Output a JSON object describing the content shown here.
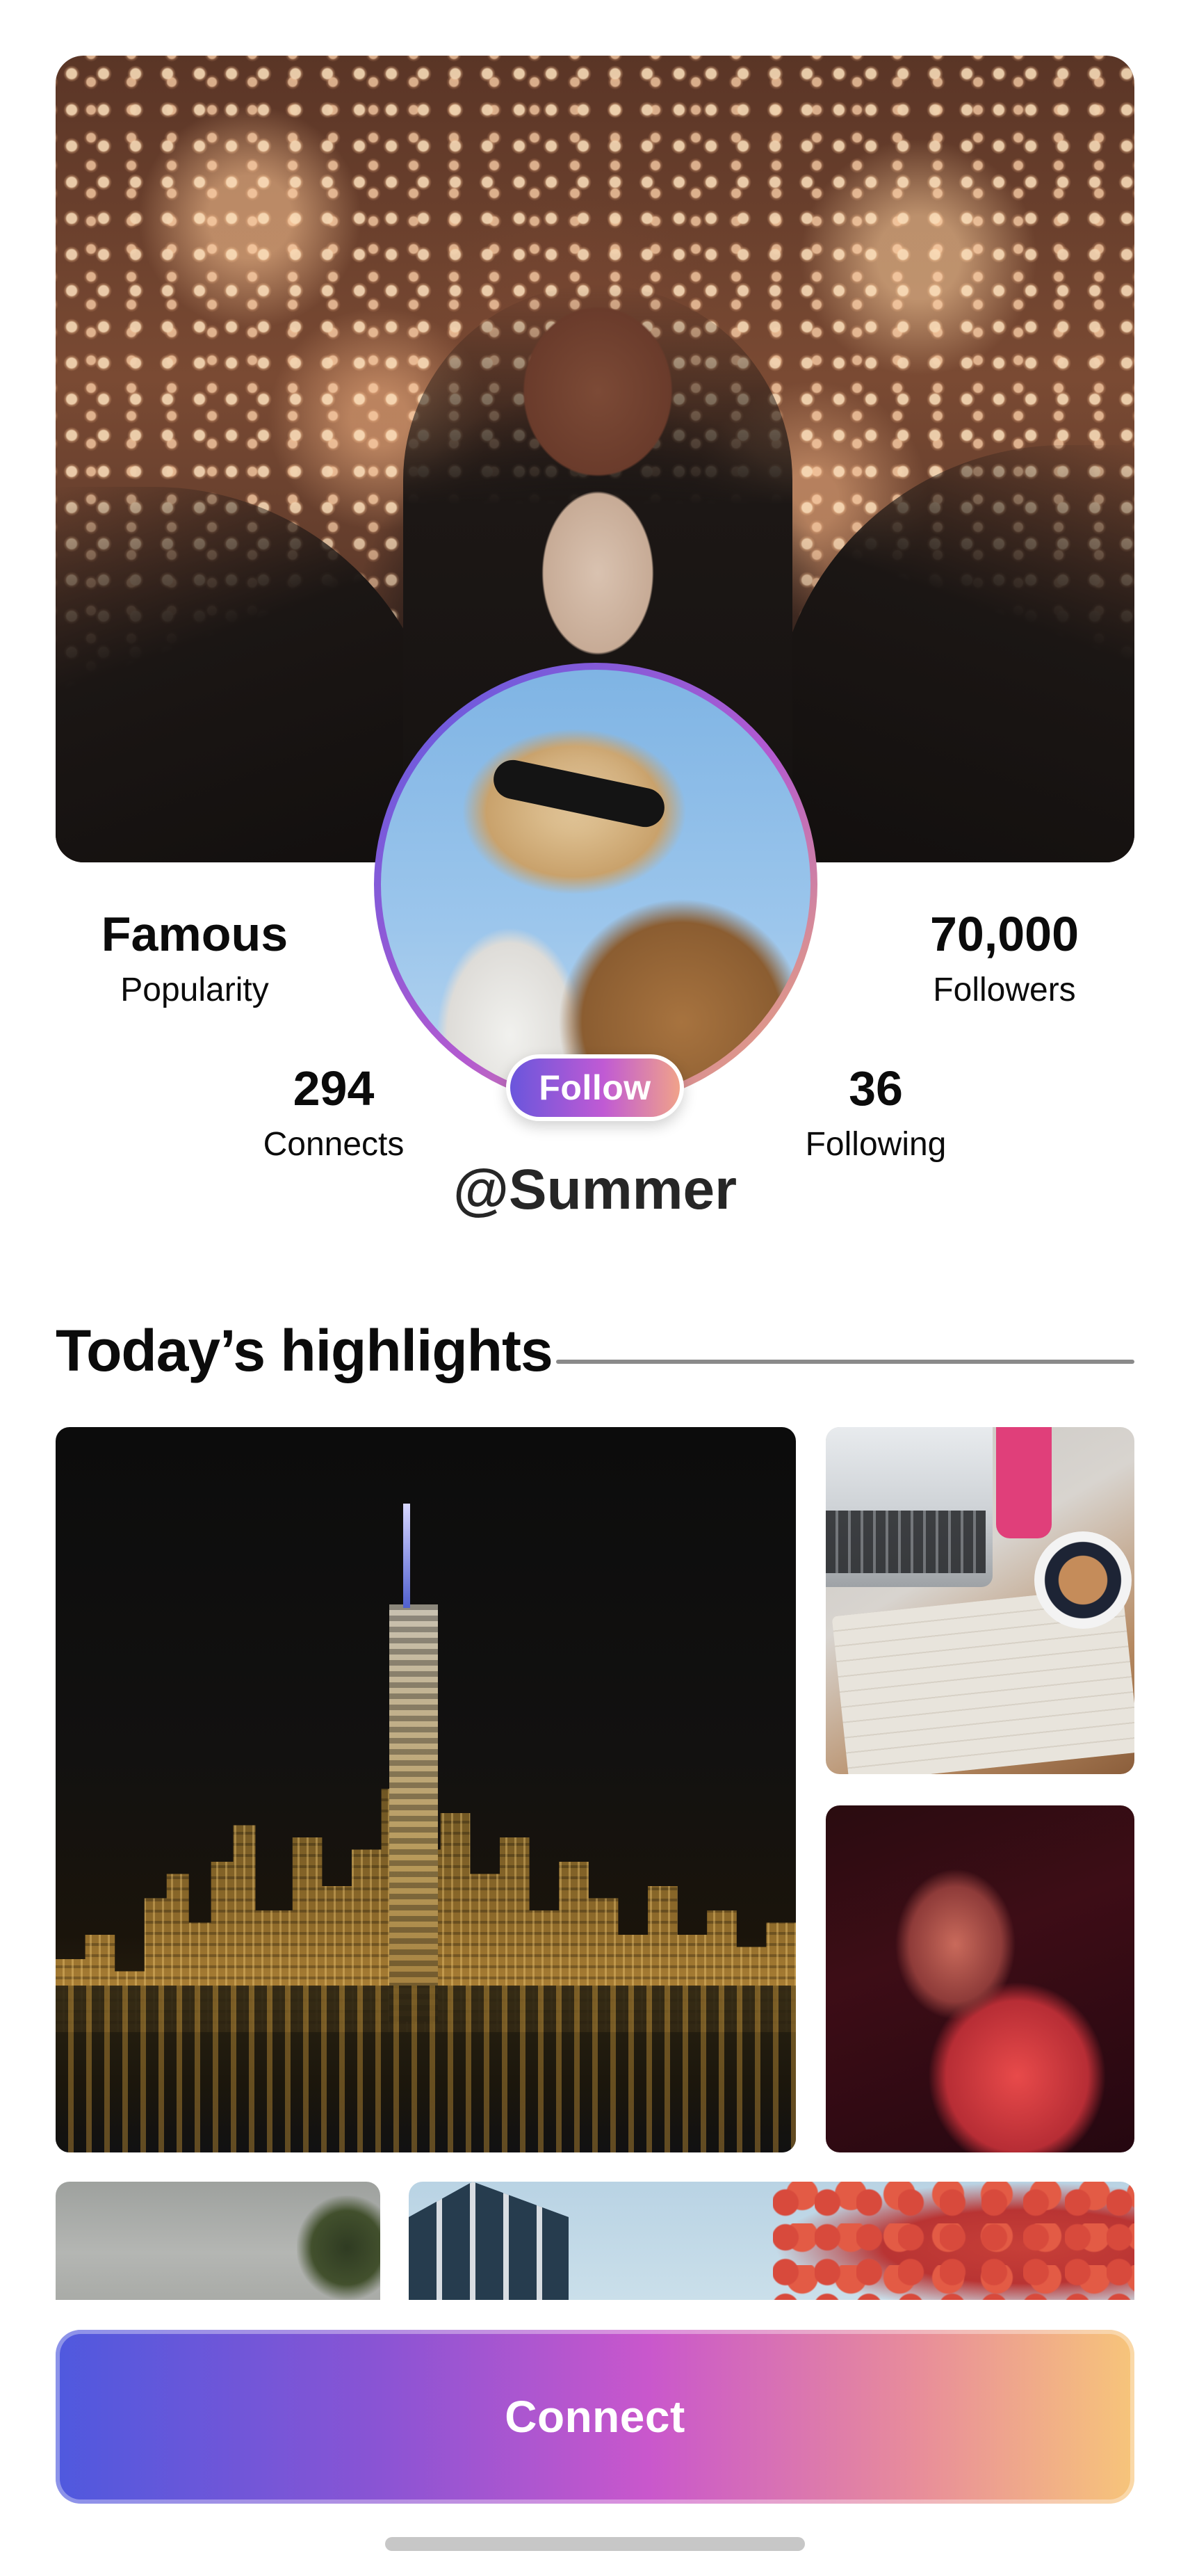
{
  "profile": {
    "username": "@Summer",
    "follow_label": "Follow",
    "cover_photo": "woman-bokeh-lights-photo",
    "avatar_photo": "woman-sunglasses-avatar"
  },
  "stats": {
    "popularity": {
      "value": "Famous",
      "label": "Popularity"
    },
    "followers": {
      "value": "70,000",
      "label": "Followers"
    },
    "connects": {
      "value": "294",
      "label": "Connects"
    },
    "following": {
      "value": "36",
      "label": "Following"
    }
  },
  "highlights": {
    "title": "Today’s highlights",
    "items": [
      {
        "icon": "city-skyline-night-photo"
      },
      {
        "icon": "desk-laptop-coffee-photo"
      },
      {
        "icon": "woman-red-light-portrait-photo"
      },
      {
        "icon": "grey-sky-plant-photo"
      },
      {
        "icon": "building-autumn-tree-photo"
      }
    ]
  },
  "actions": {
    "connect_label": "Connect"
  },
  "colors": {
    "gradient_start": "#4f59de",
    "gradient_mid": "#c957cc",
    "gradient_end": "#f7c57a",
    "text": "#0b0b0b",
    "rule": "#8a8a8a"
  }
}
